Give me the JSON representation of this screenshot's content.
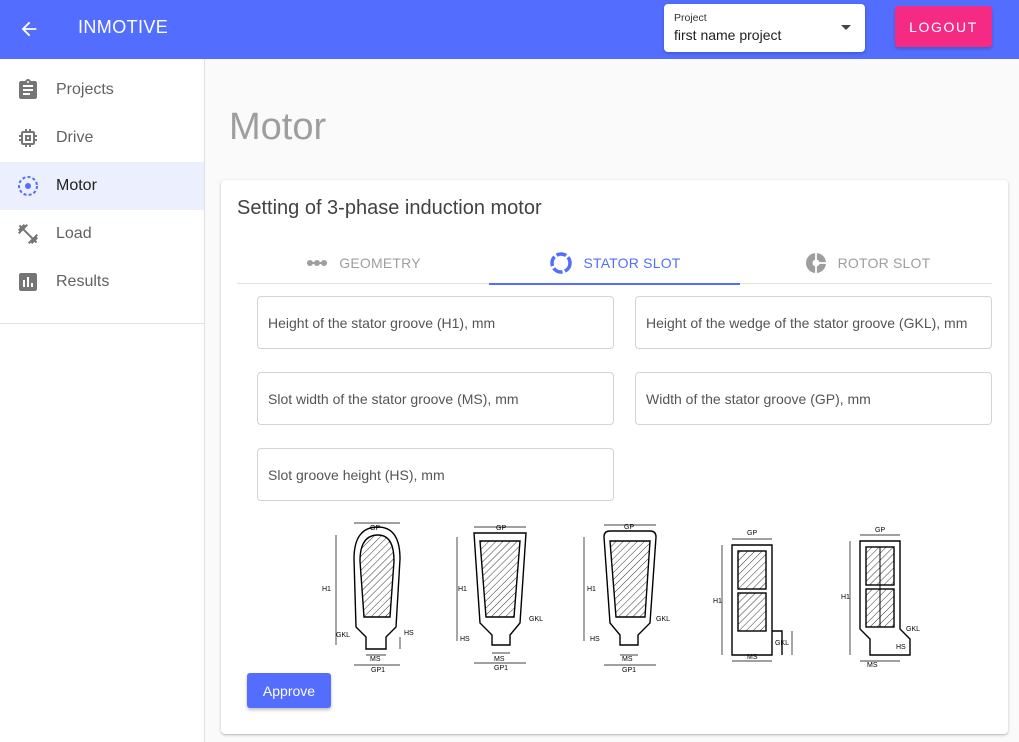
{
  "header": {
    "app_title": "INMOTIVE",
    "project_label": "Project",
    "project_value": "first name project",
    "logout_label": "LOGOUT",
    "accent_color": "#536dfe",
    "logout_color": "#f52a85"
  },
  "sidebar": {
    "items": [
      {
        "label": "Projects",
        "icon": "clipboard-icon"
      },
      {
        "label": "Drive",
        "icon": "chip-icon"
      },
      {
        "label": "Motor",
        "icon": "motor-icon",
        "active": true
      },
      {
        "label": "Load",
        "icon": "dumbbell-icon"
      },
      {
        "label": "Results",
        "icon": "bar-chart-icon"
      }
    ]
  },
  "main": {
    "page_title": "Motor",
    "card_title": "Setting of 3-phase induction motor",
    "tabs": [
      {
        "label": "GEOMETRY",
        "icon": "dots-line-icon"
      },
      {
        "label": "STATOR SLOT",
        "icon": "ring-icon",
        "active": true
      },
      {
        "label": "ROTOR SLOT",
        "icon": "rotor-icon"
      }
    ],
    "fields": [
      {
        "placeholder": "Height of the stator groove (H1), mm"
      },
      {
        "placeholder": "Height of the wedge of the stator groove (GKL), mm"
      },
      {
        "placeholder": "Slot width of the stator groove (MS), mm"
      },
      {
        "placeholder": "Width of the stator groove (GP), mm"
      },
      {
        "placeholder": "Slot groove height (HS), mm"
      }
    ],
    "diagram_labels": {
      "gp": "GP",
      "h1": "H1",
      "gkl": "GKL",
      "hs": "HS",
      "ms": "MS",
      "gp1": "GP1"
    },
    "approve_label": "Approve"
  }
}
